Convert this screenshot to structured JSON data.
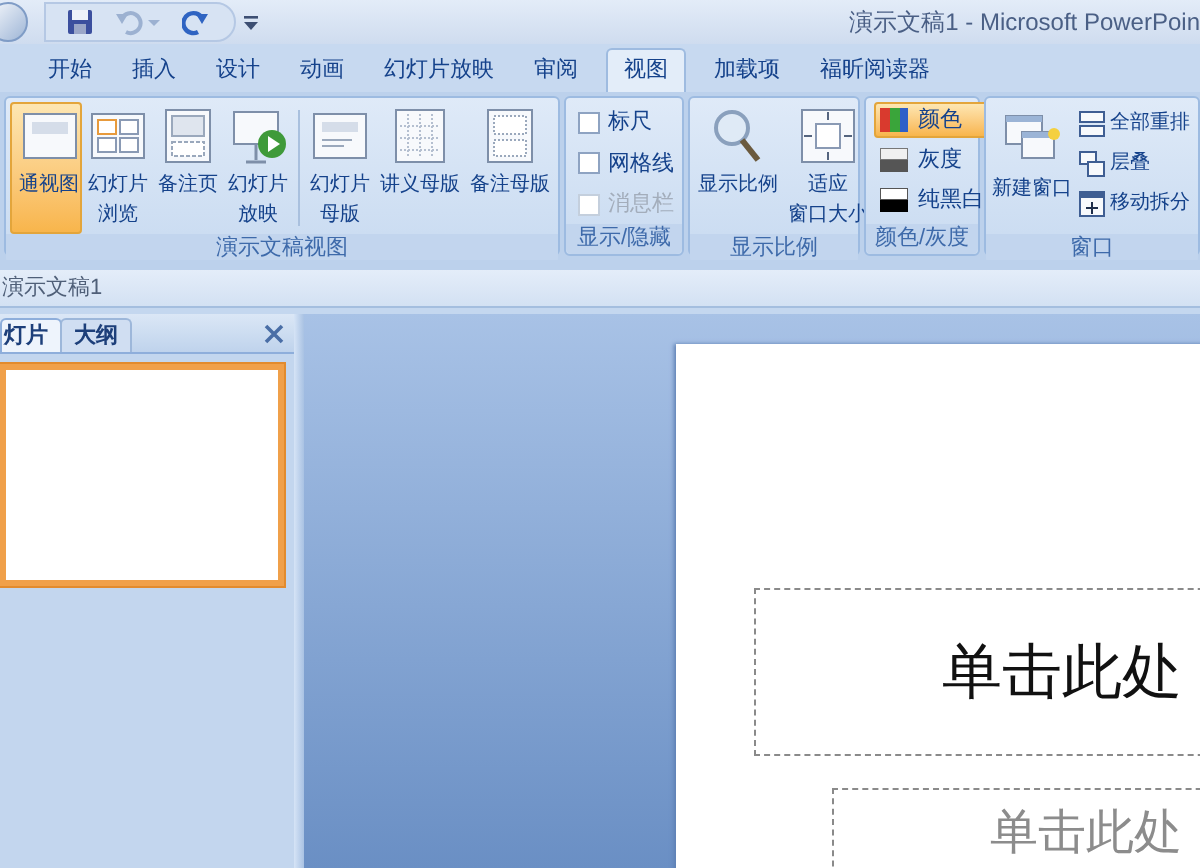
{
  "title_bar": {
    "title": "演示文稿1 - Microsoft PowerPoin"
  },
  "tabs": [
    {
      "label": "开始",
      "selected": false
    },
    {
      "label": "插入",
      "selected": false
    },
    {
      "label": "设计",
      "selected": false
    },
    {
      "label": "动画",
      "selected": false
    },
    {
      "label": "幻灯片放映",
      "selected": false
    },
    {
      "label": "审阅",
      "selected": false
    },
    {
      "label": "视图",
      "selected": true
    },
    {
      "label": "加载项",
      "selected": false
    },
    {
      "label": "福昕阅读器",
      "selected": false
    }
  ],
  "ribbon": {
    "groups": [
      {
        "label": "演示文稿视图",
        "kind": "large",
        "items": [
          {
            "lines": [
              "通视图"
            ],
            "selected": true
          },
          {
            "lines": [
              "幻灯片",
              "浏览"
            ],
            "selected": false
          },
          {
            "lines": [
              "备注页"
            ],
            "selected": false
          },
          {
            "lines": [
              "幻灯片",
              "放映"
            ],
            "selected": false
          },
          {
            "lines": [
              "幻灯片",
              "母版"
            ],
            "selected": false
          },
          {
            "lines": [
              "讲义母版"
            ],
            "selected": false
          },
          {
            "lines": [
              "备注母版"
            ],
            "selected": false
          }
        ]
      },
      {
        "label": "显示/隐藏",
        "kind": "checks",
        "items": [
          {
            "label": "标尺",
            "checked": false,
            "disabled": false
          },
          {
            "label": "网格线",
            "checked": false,
            "disabled": false
          },
          {
            "label": "消息栏",
            "checked": false,
            "disabled": true
          }
        ]
      },
      {
        "label": "显示比例",
        "kind": "large",
        "items": [
          {
            "lines": [
              "显示比例"
            ],
            "selected": false
          },
          {
            "lines": [
              "适应",
              "窗口大小"
            ],
            "selected": false
          }
        ]
      },
      {
        "label": "颜色/灰度",
        "kind": "small",
        "items": [
          {
            "label": "颜色",
            "selected": true
          },
          {
            "label": "灰度",
            "selected": false
          },
          {
            "label": "纯黑白",
            "selected": false
          }
        ]
      },
      {
        "label": "窗口",
        "kind": "window",
        "items": [
          {
            "label": "新建窗口",
            "kind": "large"
          },
          {
            "label": "全部重排",
            "kind": "small"
          },
          {
            "label": "层叠",
            "kind": "small"
          },
          {
            "label": "移动拆分",
            "kind": "small"
          }
        ]
      }
    ]
  },
  "document_bar": {
    "title": "演示文稿1"
  },
  "left_pane": {
    "tabs": [
      {
        "label": "灯片",
        "selected": true
      },
      {
        "label": "大纲",
        "selected": false
      }
    ]
  },
  "slide": {
    "title_placeholder": "单击此处",
    "subtitle_placeholder": "单击此处"
  }
}
